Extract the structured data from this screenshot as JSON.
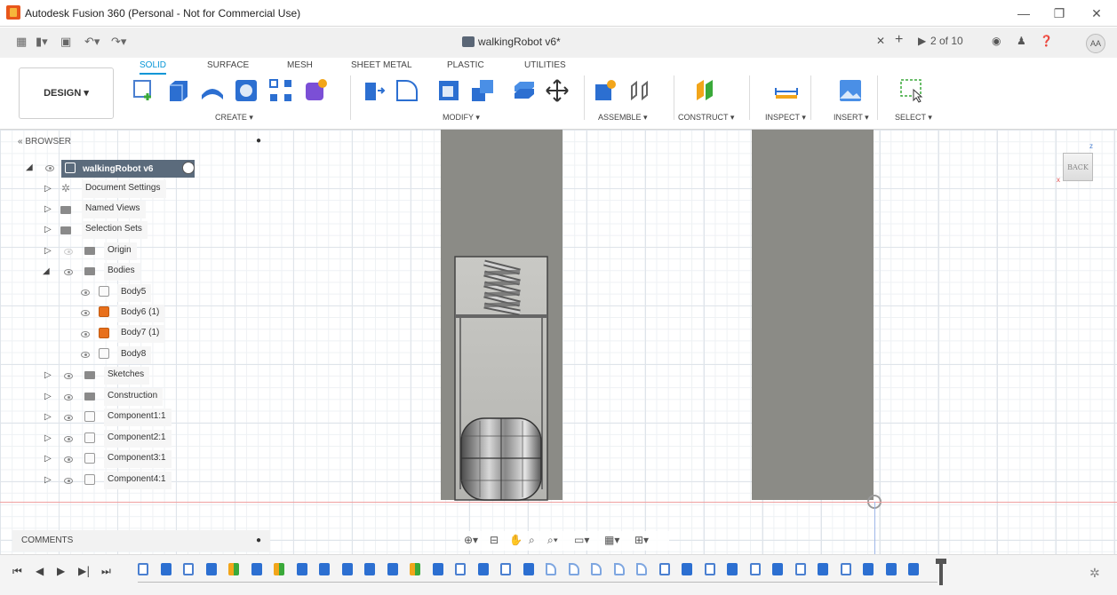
{
  "window": {
    "title": "Autodesk Fusion 360 (Personal - Not for Commercial Use)"
  },
  "document": {
    "tab_title": "walkingRobot v6*",
    "counter": "2 of 10",
    "user_initials": "AA"
  },
  "toolbar": {
    "workspace": "DESIGN ▾",
    "tabs": [
      "SOLID",
      "SURFACE",
      "MESH",
      "SHEET METAL",
      "PLASTIC",
      "UTILITIES"
    ],
    "groups": [
      "CREATE ▾",
      "MODIFY ▾",
      "ASSEMBLE ▾",
      "CONSTRUCT ▾",
      "INSPECT ▾",
      "INSERT ▾",
      "SELECT ▾"
    ]
  },
  "browser": {
    "title": "BROWSER",
    "root": "walkingRobot v6",
    "items": [
      {
        "label": "Document Settings",
        "icon": "gear-icon"
      },
      {
        "label": "Named Views",
        "icon": "folder-icon"
      },
      {
        "label": "Selection Sets",
        "icon": "folder-icon"
      },
      {
        "label": "Origin",
        "icon": "folder-icon"
      },
      {
        "label": "Bodies",
        "icon": "folder-icon"
      },
      {
        "label": "Body5",
        "icon": "body-icon"
      },
      {
        "label": "Body6 (1)",
        "icon": "body-orange-icon"
      },
      {
        "label": "Body7 (1)",
        "icon": "body-orange-icon"
      },
      {
        "label": "Body8",
        "icon": "body-icon"
      },
      {
        "label": "Sketches",
        "icon": "folder-icon"
      },
      {
        "label": "Construction",
        "icon": "folder-icon"
      },
      {
        "label": "Component1:1",
        "icon": "component-icon"
      },
      {
        "label": "Component2:1",
        "icon": "component-icon"
      },
      {
        "label": "Component3:1",
        "icon": "component-icon"
      },
      {
        "label": "Component4:1",
        "icon": "component-icon"
      }
    ]
  },
  "comments": {
    "label": "COMMENTS"
  },
  "viewcube": {
    "face": "BACK"
  },
  "colors": {
    "accent": "#0696d7",
    "part_gray": "#8a8a85",
    "timeline_blue": "#4a7fd0",
    "orange": "#e8701c"
  }
}
